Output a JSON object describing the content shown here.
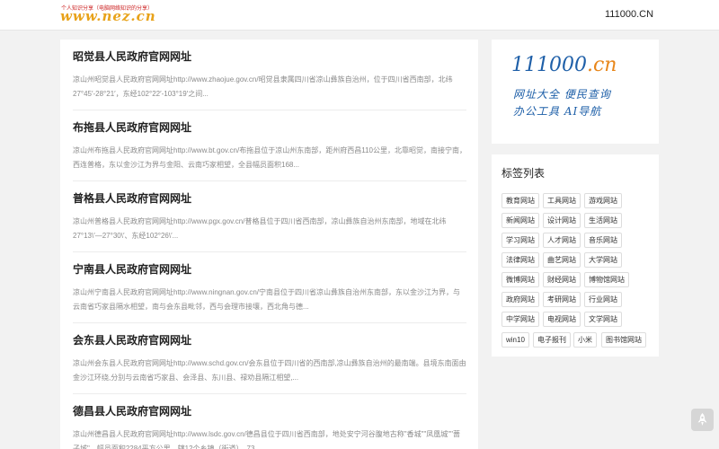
{
  "header": {
    "logo_tagline": "个人知识分享（电脑网络知识的分享）",
    "logo_text": "www.nez.cn",
    "top_link": "111000.CN"
  },
  "articles": [
    {
      "title": "昭觉县人民政府官网网址",
      "excerpt": "凉山州昭觉县人民政府官网网址http://www.zhaojue.gov.cn/昭觉县隶属四川省凉山彝族自治州，位于四川省西南部，北纬27°45′-28°21′，东经102°22′-103°19′之间..."
    },
    {
      "title": "布拖县人民政府官网网址",
      "excerpt": "凉山州布拖县人民政府官网网址http://www.bt.gov.cn/布拖县位于凉山州东南部，距州府西昌110公里，北靠昭觉，南接宁南，西连普格，东以金沙江为界与金阳、云南巧家相望，全县幅员面积168..."
    },
    {
      "title": "普格县人民政府官网网址",
      "excerpt": "凉山州普格县人民政府官网网址http://www.pgx.gov.cn/普格县位于四川省西南部，凉山彝族自治州东南部，地域在北纬27°13\\′—27°30\\′、东经102°26\\′..."
    },
    {
      "title": "宁南县人民政府官网网址",
      "excerpt": "凉山州宁南县人民政府官网网址http://www.ningnan.gov.cn/宁南县位于四川省凉山彝族自治州东南部，东以金沙江为界，与云南省巧家县隔水相望，南与会东县毗邻，西与会理市接壤，西北角与德..."
    },
    {
      "title": "会东县人民政府官网网址",
      "excerpt": "凉山州会东县人民政府官网网址http://www.schd.gov.cn/会东县位于四川省的西南部,凉山彝族自治州的最南端。县境东南面由金沙江环绕,分别与云南省巧家县、会泽县、东川县、禄劝县隔江相望,..."
    },
    {
      "title": "德昌县人民政府官网网址",
      "excerpt": "凉山州德昌县人民政府官网网址http://www.lsdc.gov.cn/德昌县位于四川省西南部，地处安宁河谷腹地古称\"香城\"\"凤凰城\"\"蔷子城\"，幅员面积2284平方公里，辖12个乡镇（街道），73..."
    }
  ],
  "banner": {
    "number": "111000",
    "suffix": ".cn",
    "line1": "网址大全  便民查询",
    "line2": "办公工具  AI导航"
  },
  "tags": {
    "title": "标签列表",
    "items": [
      "教育网站",
      "工具网站",
      "游戏网站",
      "新闻网站",
      "设计网站",
      "生活网站",
      "学习网站",
      "人才网站",
      "音乐网站",
      "法律网站",
      "曲艺网站",
      "大学网站",
      "微博网站",
      "财经网站",
      "博物馆网站",
      "政府网站",
      "考研网站",
      "行业网站",
      "中学网站",
      "电视网站",
      "文学网站",
      "win10",
      "电子报刊",
      "小米",
      "图书馆网站"
    ]
  },
  "colors": {
    "accent_blue": "#1e5fa8",
    "accent_orange": "#e8861a",
    "logo_gold": "#e8a21a"
  },
  "icons": {
    "back_to_top": "rocket-icon"
  }
}
